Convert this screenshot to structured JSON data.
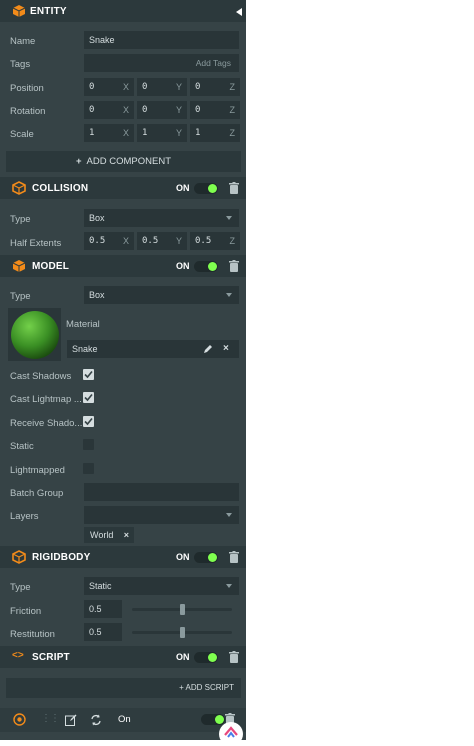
{
  "entity": {
    "title": "ENTITY",
    "name_label": "Name",
    "name_value": "Snake",
    "tags_label": "Tags",
    "tags_placeholder": "Add Tags",
    "position_label": "Position",
    "position": [
      "0",
      "0",
      "0"
    ],
    "rotation_label": "Rotation",
    "rotation": [
      "0",
      "0",
      "0"
    ],
    "scale_label": "Scale",
    "scale": [
      "1",
      "1",
      "1"
    ],
    "axes": [
      "X",
      "Y",
      "Z"
    ],
    "add_component": "ADD COMPONENT"
  },
  "collision": {
    "title": "COLLISION",
    "on": "ON",
    "type_label": "Type",
    "type_value": "Box",
    "half_extents_label": "Half Extents",
    "half_extents": [
      "0.5",
      "0.5",
      "0.5"
    ]
  },
  "model": {
    "title": "MODEL",
    "on": "ON",
    "type_label": "Type",
    "type_value": "Box",
    "material_label": "Material",
    "material_value": "Snake",
    "cast_shadows": "Cast Shadows",
    "cast_lightmap": "Cast Lightmap ...",
    "receive_shadows": "Receive Shado...",
    "static": "Static",
    "lightmapped": "Lightmapped",
    "batch_group": "Batch Group",
    "layers": "Layers",
    "layer_tag": "World"
  },
  "rigidbody": {
    "title": "RIGIDBODY",
    "on": "ON",
    "type_label": "Type",
    "type_value": "Static",
    "friction_label": "Friction",
    "friction_value": "0.5",
    "friction": 0.5,
    "restitution_label": "Restitution",
    "restitution_value": "0.5",
    "restitution": 0.5
  },
  "script": {
    "title": "SCRIPT",
    "on": "ON",
    "add_script": "+ ADD SCRIPT",
    "row_state": "On"
  },
  "colors": {
    "accent": "#f28b1a",
    "toggle_on": "#7fff4f",
    "panel": "#364346",
    "header": "#2c393c"
  }
}
